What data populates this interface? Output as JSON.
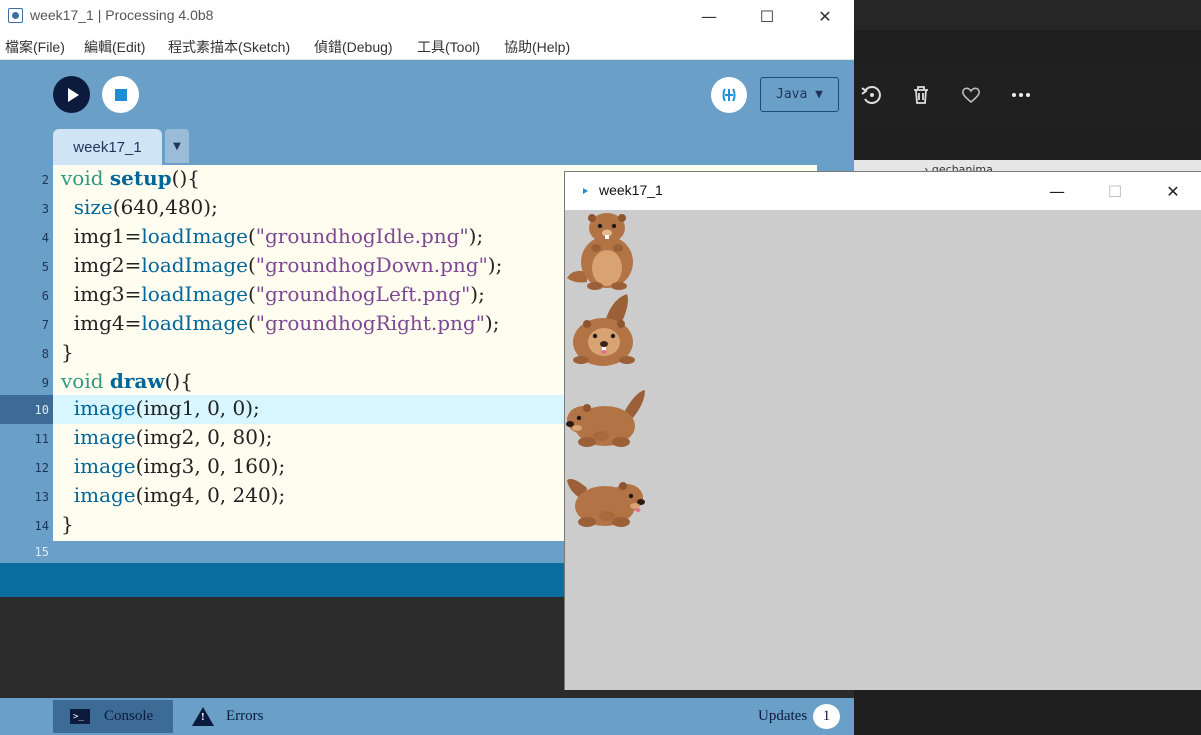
{
  "ide": {
    "title": "week17_1 | Processing 4.0b8",
    "menu": [
      "檔案(File)",
      "編輯(Edit)",
      "程式素描本(Sketch)",
      "偵錯(Debug)",
      "工具(Tool)",
      "協助(Help)"
    ],
    "mode": "Java ▼",
    "tab": "week17_1",
    "tab_menu": "▼",
    "code_lines": [
      {
        "num": "2"
      },
      {
        "num": "3"
      },
      {
        "num": "4"
      },
      {
        "num": "5"
      },
      {
        "num": "6"
      },
      {
        "num": "7"
      },
      {
        "num": "8"
      },
      {
        "num": "9"
      },
      {
        "num": "10"
      },
      {
        "num": "11"
      },
      {
        "num": "12"
      },
      {
        "num": "13"
      },
      {
        "num": "14"
      },
      {
        "num": "15"
      }
    ],
    "code": {
      "l2": [
        "void",
        " ",
        "setup",
        "(){"
      ],
      "l3": [
        "  ",
        "size",
        "(640,480);"
      ],
      "l4": [
        "  img1=",
        "loadImage",
        "(",
        "\"groundhogIdle.png\"",
        ");"
      ],
      "l5": [
        "  img2=",
        "loadImage",
        "(",
        "\"groundhogDown.png\"",
        ");"
      ],
      "l6": [
        "  img3=",
        "loadImage",
        "(",
        "\"groundhogLeft.png\"",
        ");"
      ],
      "l7": [
        "  img4=",
        "loadImage",
        "(",
        "\"groundhogRight.png\"",
        ");"
      ],
      "l8": [
        "}"
      ],
      "l9": [
        "void",
        " ",
        "draw",
        "(){"
      ],
      "l10": [
        "  ",
        "image",
        "(img1, 0, 0);"
      ],
      "l11": [
        "  ",
        "image",
        "(img2, 0, 80);"
      ],
      "l12": [
        "  ",
        "image",
        "(img3, 0, 160);"
      ],
      "l13": [
        "  ",
        "image",
        "(img4, 0, 240);"
      ],
      "l14": [
        "}"
      ]
    },
    "bottom": {
      "console": "Console",
      "errors": "Errors",
      "updates": "Updates",
      "updates_count": "1"
    }
  },
  "sketch_window": {
    "title": "week17_1",
    "canvas_background": "#cccccc",
    "sprites": [
      "groundhog-idle",
      "groundhog-down",
      "groundhog-left",
      "groundhog-right"
    ]
  },
  "background_app": {
    "folder_text": "› gechanima"
  },
  "colors": {
    "ide_bg": "#6a9fc8",
    "editor_bg": "#fffdf0",
    "highlight": "#d8f6ff",
    "keyword_type": "#33997e",
    "keyword_fn": "#006699",
    "string": "#7d4793",
    "status_bar": "#0a6ea0"
  }
}
